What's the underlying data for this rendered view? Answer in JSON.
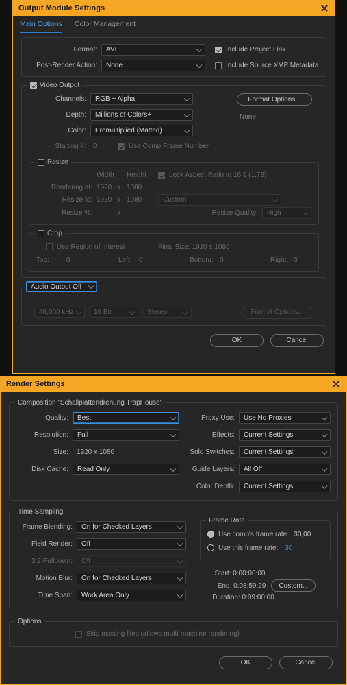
{
  "output_module": {
    "title": "Output Module Settings",
    "close_icon": "close-icon",
    "tabs": [
      {
        "label": "Main Options",
        "active": true
      },
      {
        "label": "Color Management",
        "active": false
      }
    ],
    "format_label": "Format:",
    "format_value": "AVI",
    "post_render_label": "Post-Render Action:",
    "post_render_value": "None",
    "include_project_link": "Include Project Link",
    "include_xmp": "Include Source XMP Metadata",
    "video_output_legend": "Video Output",
    "channels_label": "Channels:",
    "channels_value": "RGB + Alpha",
    "depth_label": "Depth:",
    "depth_value": "Millions of Colors+",
    "color_label": "Color:",
    "color_value": "Premultiplied (Matted)",
    "starting_label": "Starting #:",
    "starting_value": "0",
    "use_comp_frame_number": "Use Comp Frame Number",
    "format_options_button": "Format Options...",
    "format_options_status": "None",
    "resize_legend": "Resize",
    "width_header": "Width",
    "height_header": "Height",
    "lock_aspect": "Lock Aspect Ratio to 16:9 (1,78)",
    "rendering_at_label": "Rendering at:",
    "rendering_at_width": "1920",
    "rendering_at_x": "x",
    "rendering_at_height": "1080",
    "resize_to_label": "Resize to:",
    "resize_to_width": "1920",
    "resize_to_x": "x",
    "resize_to_height": "1080",
    "resize_preset": "Custom",
    "resize_pct_label": "Resize %:",
    "resize_pct_x": "x",
    "resize_quality_label": "Resize Quality:",
    "resize_quality_value": "High",
    "crop_legend": "Crop",
    "use_region_of_interest": "Use Region of Interest",
    "final_size": "Final Size: 1920 x 1080",
    "top_label": "Top:",
    "top_value": "0",
    "left_label": "Left:",
    "left_value": "0",
    "bottom_label": "Bottom:",
    "bottom_value": "0",
    "right_label": "Right:",
    "right_value": "0",
    "audio_output_value": "Audio Output Off",
    "audio_rate": "48,000 kHz",
    "audio_depth": "16 Bit",
    "audio_channels": "Stereo",
    "audio_format_options": "Format Options...",
    "ok_label": "OK",
    "cancel_label": "Cancel"
  },
  "render_settings": {
    "title": "Render Settings",
    "close_icon": "close-icon",
    "composition_legend": "Composition \"Schallplattendrehung TrapHouse\"",
    "quality_label": "Quality:",
    "quality_value": "Best",
    "resolution_label": "Resolution:",
    "resolution_value": "Full",
    "size_label": "Size:",
    "size_value": "1920 x 1080",
    "disk_cache_label": "Disk Cache:",
    "disk_cache_value": "Read Only",
    "proxy_use_label": "Proxy Use:",
    "proxy_use_value": "Use No Proxies",
    "effects_label": "Effects:",
    "effects_value": "Current Settings",
    "solo_switches_label": "Solo Switches:",
    "solo_switches_value": "Current Settings",
    "guide_layers_label": "Guide Layers:",
    "guide_layers_value": "All Off",
    "color_depth_label": "Color Depth:",
    "color_depth_value": "Current Settings",
    "time_sampling_legend": "Time Sampling",
    "frame_blending_label": "Frame Blending:",
    "frame_blending_value": "On for Checked Layers",
    "field_render_label": "Field Render:",
    "field_render_value": "Off",
    "pulldown_label": "3:2 Pulldown:",
    "pulldown_value": "Off",
    "motion_blur_label": "Motion Blur:",
    "motion_blur_value": "On for Checked Layers",
    "time_span_label": "Time Span:",
    "time_span_value": "Work Area Only",
    "frame_rate_legend": "Frame Rate",
    "use_comps_frame_rate": "Use comp's frame rate",
    "comps_frame_rate_value": "30,00",
    "use_this_frame_rate": "Use this frame rate:",
    "this_frame_rate_value": "30",
    "start_label": "Start: 0:00:00:00",
    "end_label": "End: 0:08:59:29",
    "duration_label": "Duration: 0:09:00:00",
    "custom_button": "Custom...",
    "options_legend": "Options",
    "skip_existing": "Skip existing files (allows multi-machine rendering)",
    "ok_label": "OK",
    "cancel_label": "Cancel"
  },
  "theme": {
    "accent": "#f6a623",
    "focus_blue": "#3e8fdd",
    "panel_bg": "#262626",
    "field_bg": "#1c1c1c"
  }
}
